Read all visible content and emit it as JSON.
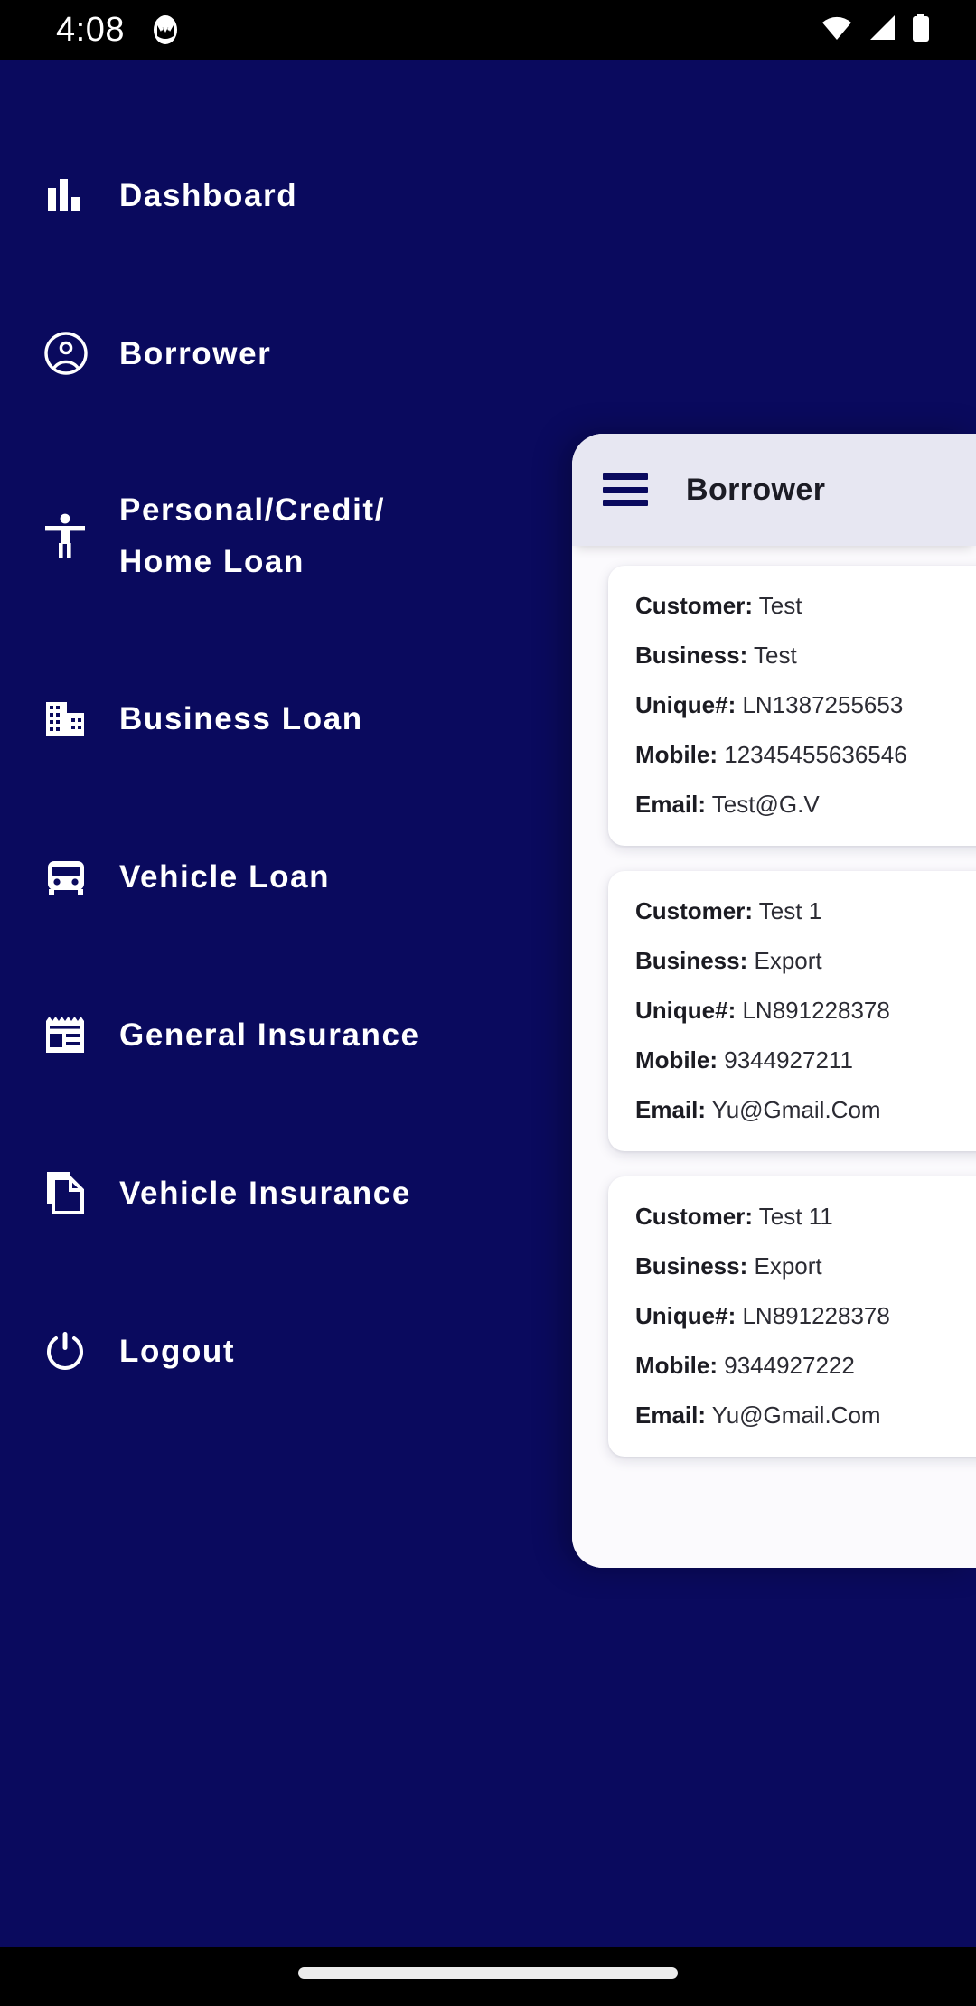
{
  "status_bar": {
    "time": "4:08",
    "notification_icon": "app-notification-icon",
    "wifi_icon": "wifi-icon",
    "signal_icon": "cell-signal-icon",
    "battery_icon": "battery-full-icon"
  },
  "drawer": {
    "background_color": "#0A0A5E",
    "items": [
      {
        "label": "Dashboard",
        "icon": "bar-chart-icon"
      },
      {
        "label": "Borrower",
        "icon": "account-circle-icon"
      },
      {
        "label": "Personal/Credit/\nHome Loan",
        "icon": "accessibility-person-icon"
      },
      {
        "label": "Business Loan",
        "icon": "building-icon"
      },
      {
        "label": "Vehicle Loan",
        "icon": "bus-icon"
      },
      {
        "label": "General Insurance",
        "icon": "receipt-icon"
      },
      {
        "label": "Vehicle Insurance",
        "icon": "copy-document-icon"
      },
      {
        "label": "Logout",
        "icon": "power-icon"
      }
    ]
  },
  "panel": {
    "header": {
      "menu_icon": "hamburger-menu-icon",
      "title": "Borrower",
      "background_color": "#E7E7F2",
      "title_color": "#1C1C25"
    },
    "field_labels": {
      "customer": "Customer:",
      "business": "Business:",
      "unique": "Unique#:",
      "mobile": "Mobile:",
      "email": "Email:"
    },
    "cards": [
      {
        "customer": "Test",
        "business": "Test",
        "unique": "LN1387255653",
        "mobile": "12345455636546",
        "email": "Test@G.V"
      },
      {
        "customer": "Test 1",
        "business": "Export",
        "unique": "LN891228378",
        "mobile": "9344927211",
        "email": "Yu@Gmail.Com"
      },
      {
        "customer": "Test 11",
        "business": "Export",
        "unique": "LN891228378",
        "mobile": "9344927222",
        "email": "Yu@Gmail.Com"
      }
    ]
  },
  "nav_bar": {
    "gesture_pill": "home-gesture-pill"
  }
}
